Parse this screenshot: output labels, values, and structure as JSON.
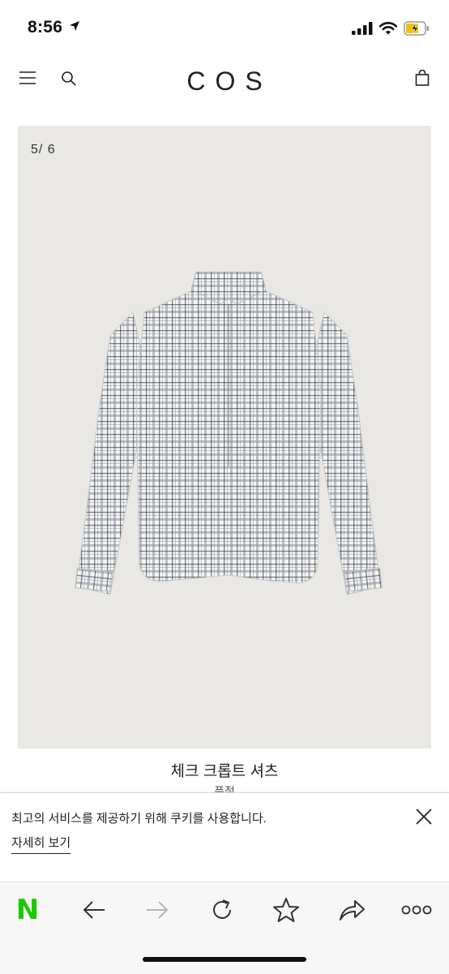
{
  "status_bar": {
    "time": "8:56"
  },
  "header": {
    "brand": "COS"
  },
  "product": {
    "image_counter": "5/ 6",
    "title": "체크 크롭트 셔츠",
    "subtitle": "품절"
  },
  "cookie_banner": {
    "message": "최고의 서비스를 제공하기 위해 쿠키를 사용합니다.",
    "link_label": "자세히 보기"
  },
  "toolbar": {
    "naver_label": "N"
  },
  "colors": {
    "naver_green": "#1ec800",
    "image_bg": "#e9e8e4"
  },
  "icons": [
    "location-arrow-icon",
    "signal-icon",
    "wifi-icon",
    "battery-charging-icon",
    "menu-icon",
    "search-icon",
    "bag-icon",
    "close-icon",
    "back-arrow-icon",
    "forward-arrow-icon",
    "reload-icon",
    "star-icon",
    "share-icon",
    "more-icon"
  ]
}
